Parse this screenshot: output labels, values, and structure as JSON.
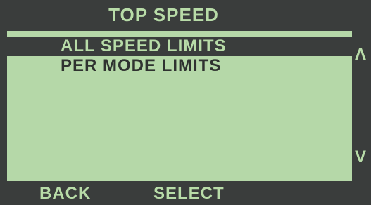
{
  "header": {
    "title": "TOP SPEED"
  },
  "menu": {
    "items": [
      {
        "label": "ALL SPEED LIMITS",
        "selected": true
      },
      {
        "label": "PER MODE LIMITS",
        "selected": false
      }
    ]
  },
  "scroll": {
    "up_glyph": "Λ",
    "down_glyph": "V"
  },
  "softkeys": {
    "left_label": "BACK",
    "right_label": "SELECT"
  },
  "colors": {
    "lcd_background": "#b5d8a8",
    "bezel": "#3a3d3c",
    "highlight_text": "#b8dca8",
    "normal_text": "#2f3230"
  }
}
